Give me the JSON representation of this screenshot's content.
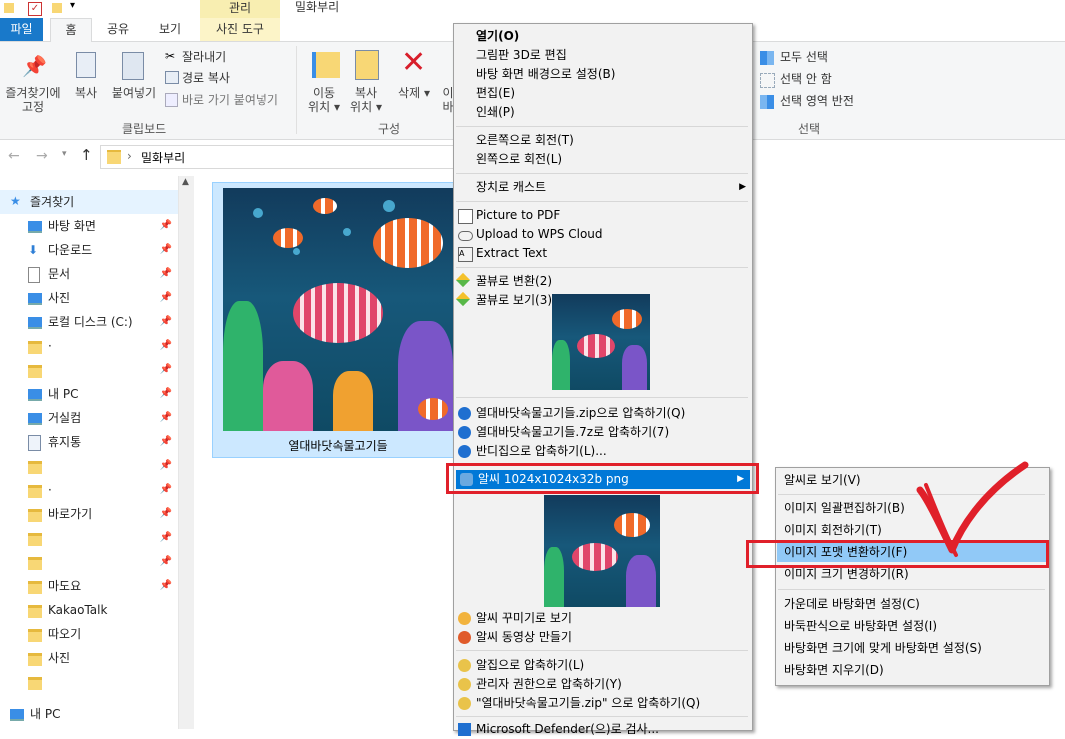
{
  "title": {
    "folder": "밀화부리",
    "context_header": "관리"
  },
  "tabs": [
    {
      "label": "파일"
    },
    {
      "label": "홈"
    },
    {
      "label": "공유"
    },
    {
      "label": "보기"
    },
    {
      "label": "사진 도구"
    }
  ],
  "ribbon": {
    "pin_label_1": "즐겨찾기에",
    "pin_label_2": "고정",
    "copy_label": "복사",
    "paste_label": "붙여넣기",
    "cut_label": "잘라내기",
    "copy_path_label": "경로 복사",
    "paste_shortcut_label": "바로 가기 붙여넣기",
    "clipboard_group": "클립보드",
    "move_label_1": "이동",
    "move_label_2": "위치",
    "copyto_label_1": "복사",
    "copyto_label_2": "위치",
    "delete_label": "삭제",
    "rename_partial_1": "이",
    "rename_partial_2": "바",
    "organize_group": "구성",
    "select_all": "모두 선택",
    "select_none": "선택 안 함",
    "invert_selection": "선택 영역 반전",
    "select_group": "선택"
  },
  "address": {
    "path": "밀화부리"
  },
  "nav": [
    {
      "label": "즐겨찾기",
      "pinned": false
    },
    {
      "label": "바탕 화면",
      "pinned": true
    },
    {
      "label": "다운로드",
      "pinned": true
    },
    {
      "label": "문서",
      "pinned": true
    },
    {
      "label": "사진",
      "pinned": true
    },
    {
      "label": "로컬 디스크 (C:)",
      "pinned": true
    },
    {
      "label": "·",
      "pinned": true
    },
    {
      "label": "",
      "pinned": true
    },
    {
      "label": "내 PC",
      "pinned": true
    },
    {
      "label": "거실컴",
      "pinned": true
    },
    {
      "label": "휴지통",
      "pinned": true
    },
    {
      "label": "",
      "pinned": true
    },
    {
      "label": "·",
      "pinned": true
    },
    {
      "label": "바로가기",
      "pinned": true
    },
    {
      "label": "",
      "pinned": true
    },
    {
      "label": "",
      "pinned": true
    },
    {
      "label": "마도요",
      "pinned": true
    },
    {
      "label": "KakaoTalk",
      "pinned": false
    },
    {
      "label": "따오기",
      "pinned": false
    },
    {
      "label": "사진",
      "pinned": false
    },
    {
      "label": "",
      "pinned": false
    },
    {
      "label": "내 PC",
      "pinned": false
    }
  ],
  "file": {
    "name": "열대바닷속물고기들"
  },
  "context_menu": {
    "items": [
      "열기(O)",
      "그림판 3D로 편집",
      "바탕 화면 배경으로 설정(B)",
      "편집(E)",
      "인쇄(P)",
      "오른쪽으로 회전(T)",
      "왼쪽으로 회전(L)",
      "장치로 캐스트",
      "Picture to PDF",
      "Upload to WPS Cloud",
      "Extract Text",
      "꿀뷰로 변환(2)",
      "꿀뷰로 보기(3)",
      "열대바닷속물고기들.zip으로 압축하기(Q)",
      "열대바닷속물고기들.7z로 압축하기(7)",
      "반디집으로 압축하기(L)...",
      "알씨 1024x1024x32b png",
      "알씨 꾸미기로 보기",
      "알씨 동영상 만들기",
      "알집으로 압축하기(L)",
      "관리자 권한으로 압축하기(Y)",
      "\"열대바닷속물고기들.zip\" 으로 압축하기(Q)",
      "Microsoft Defender(으)로 검사..."
    ]
  },
  "submenu": {
    "items": [
      "알씨로 보기(V)",
      "이미지 일괄편집하기(B)",
      "이미지 회전하기(T)",
      "이미지 포맷 변환하기(F)",
      "이미지 크기 변경하기(R)",
      "가운데로 바탕화면 설정(C)",
      "바둑판식으로 바탕화면 설정(I)",
      "바탕화면 크기에 맞게 바탕화면 설정(S)",
      "바탕화면 지우기(D)"
    ]
  },
  "colors": {
    "accent": "#1979ca",
    "highlight": "#91c9f7",
    "annotation_red": "#e0202a"
  }
}
